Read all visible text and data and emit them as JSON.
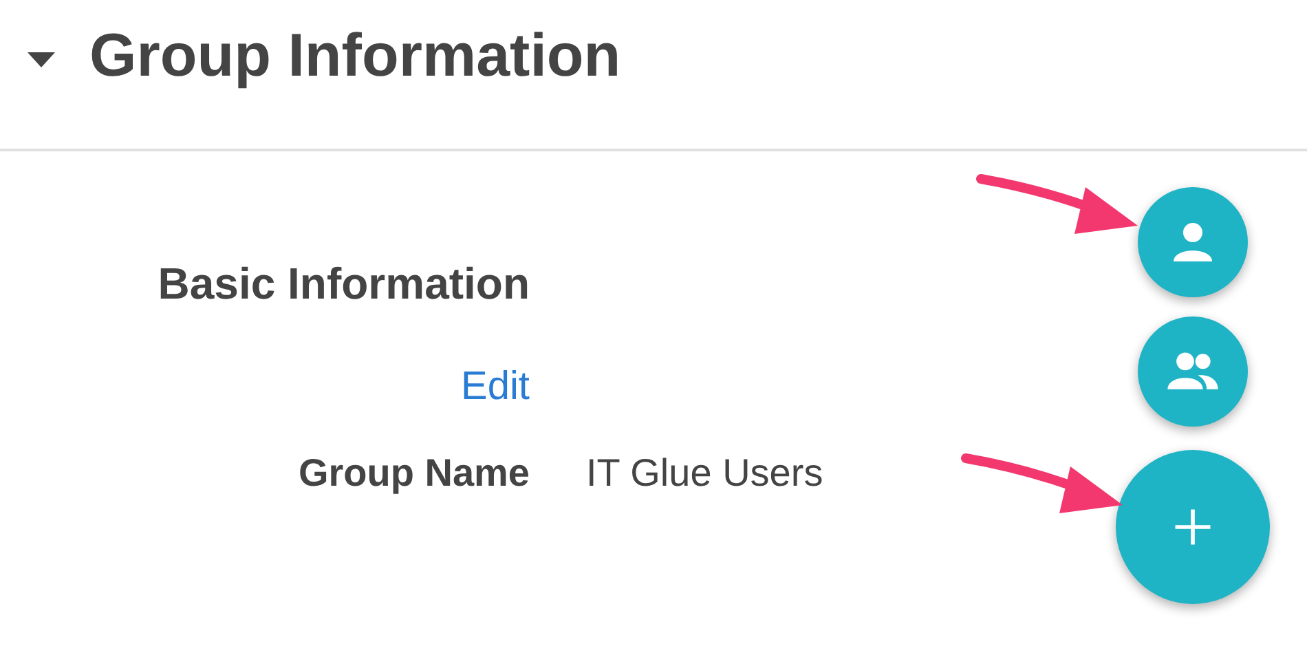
{
  "section": {
    "title": "Group Information",
    "expanded": true
  },
  "basic_information": {
    "title": "Basic Information",
    "edit_link": "Edit",
    "fields": [
      {
        "label": "Group Name",
        "value": "IT Glue Users"
      }
    ]
  },
  "action_buttons": [
    {
      "kind": "person"
    },
    {
      "kind": "group"
    },
    {
      "kind": "add"
    }
  ],
  "annotations": [
    {
      "kind": "arrow"
    },
    {
      "kind": "arrow"
    }
  ]
}
